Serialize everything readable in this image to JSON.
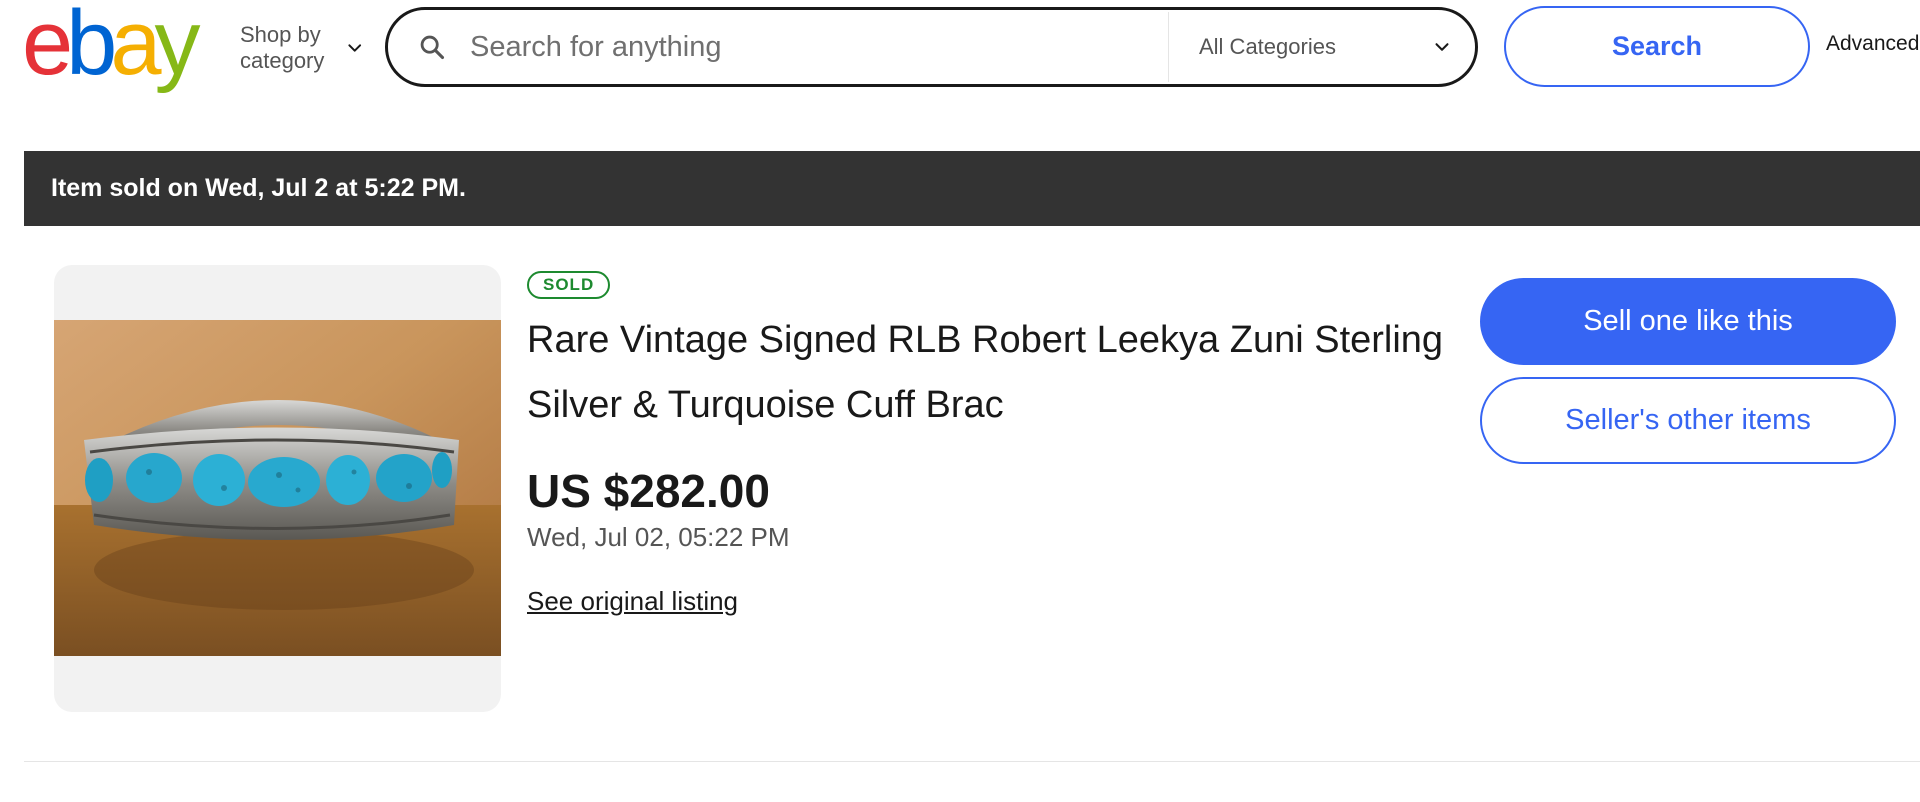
{
  "header": {
    "logo": {
      "letters": [
        "e",
        "b",
        "a",
        "y"
      ],
      "colors": [
        "#e53238",
        "#0064d2",
        "#f5af02",
        "#86b817"
      ]
    },
    "shop_by_category": "Shop by category",
    "search": {
      "placeholder": "Search for anything",
      "value": "",
      "category": "All Categories"
    },
    "search_button": "Search",
    "advanced_link": "Advanced"
  },
  "banner": {
    "text": "Item sold on Wed, Jul 2 at 5:22 PM."
  },
  "item": {
    "status_badge": "SOLD",
    "title": "Rare Vintage Signed RLB Robert Leekya Zuni Sterling Silver & Turquoise Cuff Brac",
    "price": "US $282.00",
    "sold_date": "Wed, Jul 02, 05:22 PM",
    "original_listing_link": "See original listing",
    "image_subject": "turquoise-silver-cuff-bracelet"
  },
  "actions": {
    "sell_one": "Sell one like this",
    "seller_other_items": "Seller's other items"
  },
  "colors": {
    "accent_blue": "#3665f3",
    "sold_green": "#1d8a2f",
    "banner_bg": "#333333"
  },
  "icons": {
    "search": "search-icon",
    "chevron": "chevron-down-icon"
  }
}
